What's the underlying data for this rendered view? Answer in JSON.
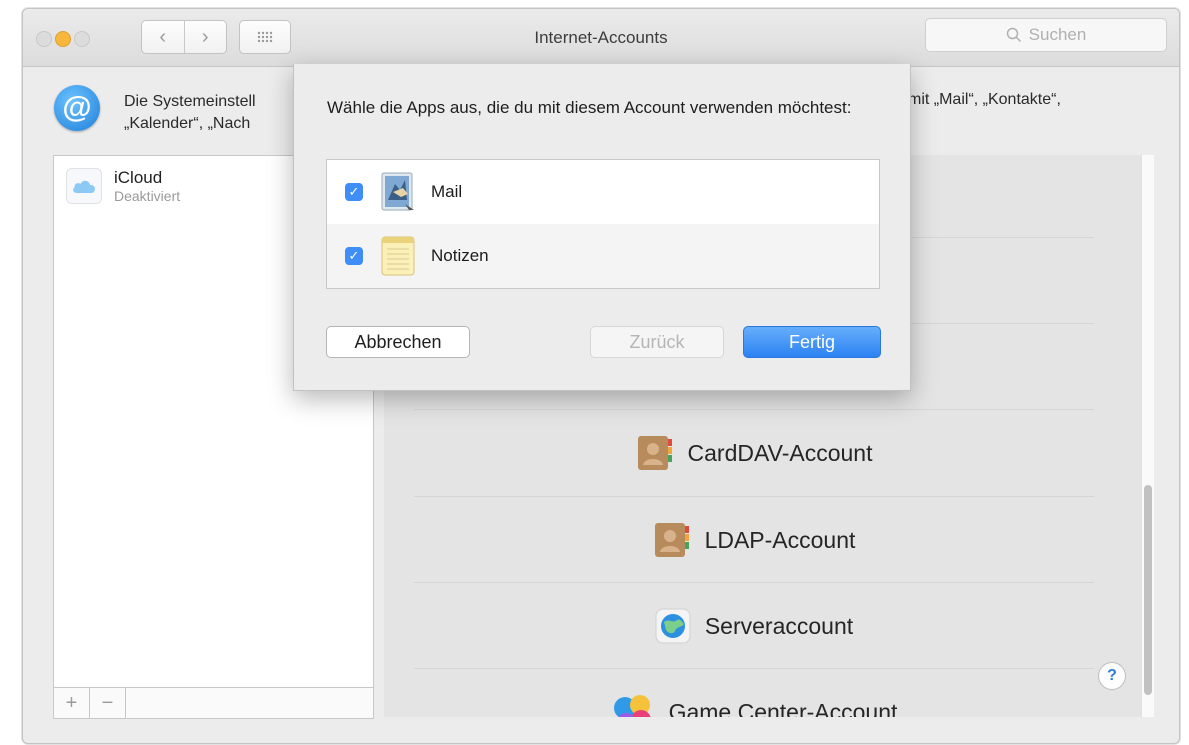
{
  "window": {
    "title": "Internet-Accounts"
  },
  "toolbar": {
    "back_glyph": "‹",
    "forward_glyph": "›",
    "search_placeholder": "Suchen"
  },
  "header": {
    "line1": "Die Systemeinstell",
    "line2": "„Kalender“, „Nach",
    "right_text": "mit „Mail“, „Kontakte“,"
  },
  "accounts": [
    {
      "name": "iCloud",
      "status": "Deaktiviert",
      "icon": "cloud-icon"
    }
  ],
  "left_footer": {
    "add": "+",
    "remove": "−"
  },
  "services": [
    {
      "label": "CardDAV-Account",
      "icon": "contacts-book-icon"
    },
    {
      "label": "LDAP-Account",
      "icon": "contacts-book-icon"
    },
    {
      "label": "Serveraccount",
      "icon": "globe-icon"
    },
    {
      "label": "Game Center-Account",
      "icon": "game-center-icon"
    }
  ],
  "help": "?",
  "sheet": {
    "message": "Wähle die Apps aus, die du mit diesem Account verwenden möchtest:",
    "apps": [
      {
        "label": "Mail",
        "checked": true,
        "icon": "mail-stamp-icon"
      },
      {
        "label": "Notizen",
        "checked": true,
        "icon": "notes-icon"
      }
    ],
    "buttons": {
      "cancel": "Abbrechen",
      "back": "Zurück",
      "done": "Fertig"
    }
  },
  "colors": {
    "accent": "#2c82f1",
    "checkbox": "#3f8ef5",
    "minimize": "#f6b73c"
  }
}
